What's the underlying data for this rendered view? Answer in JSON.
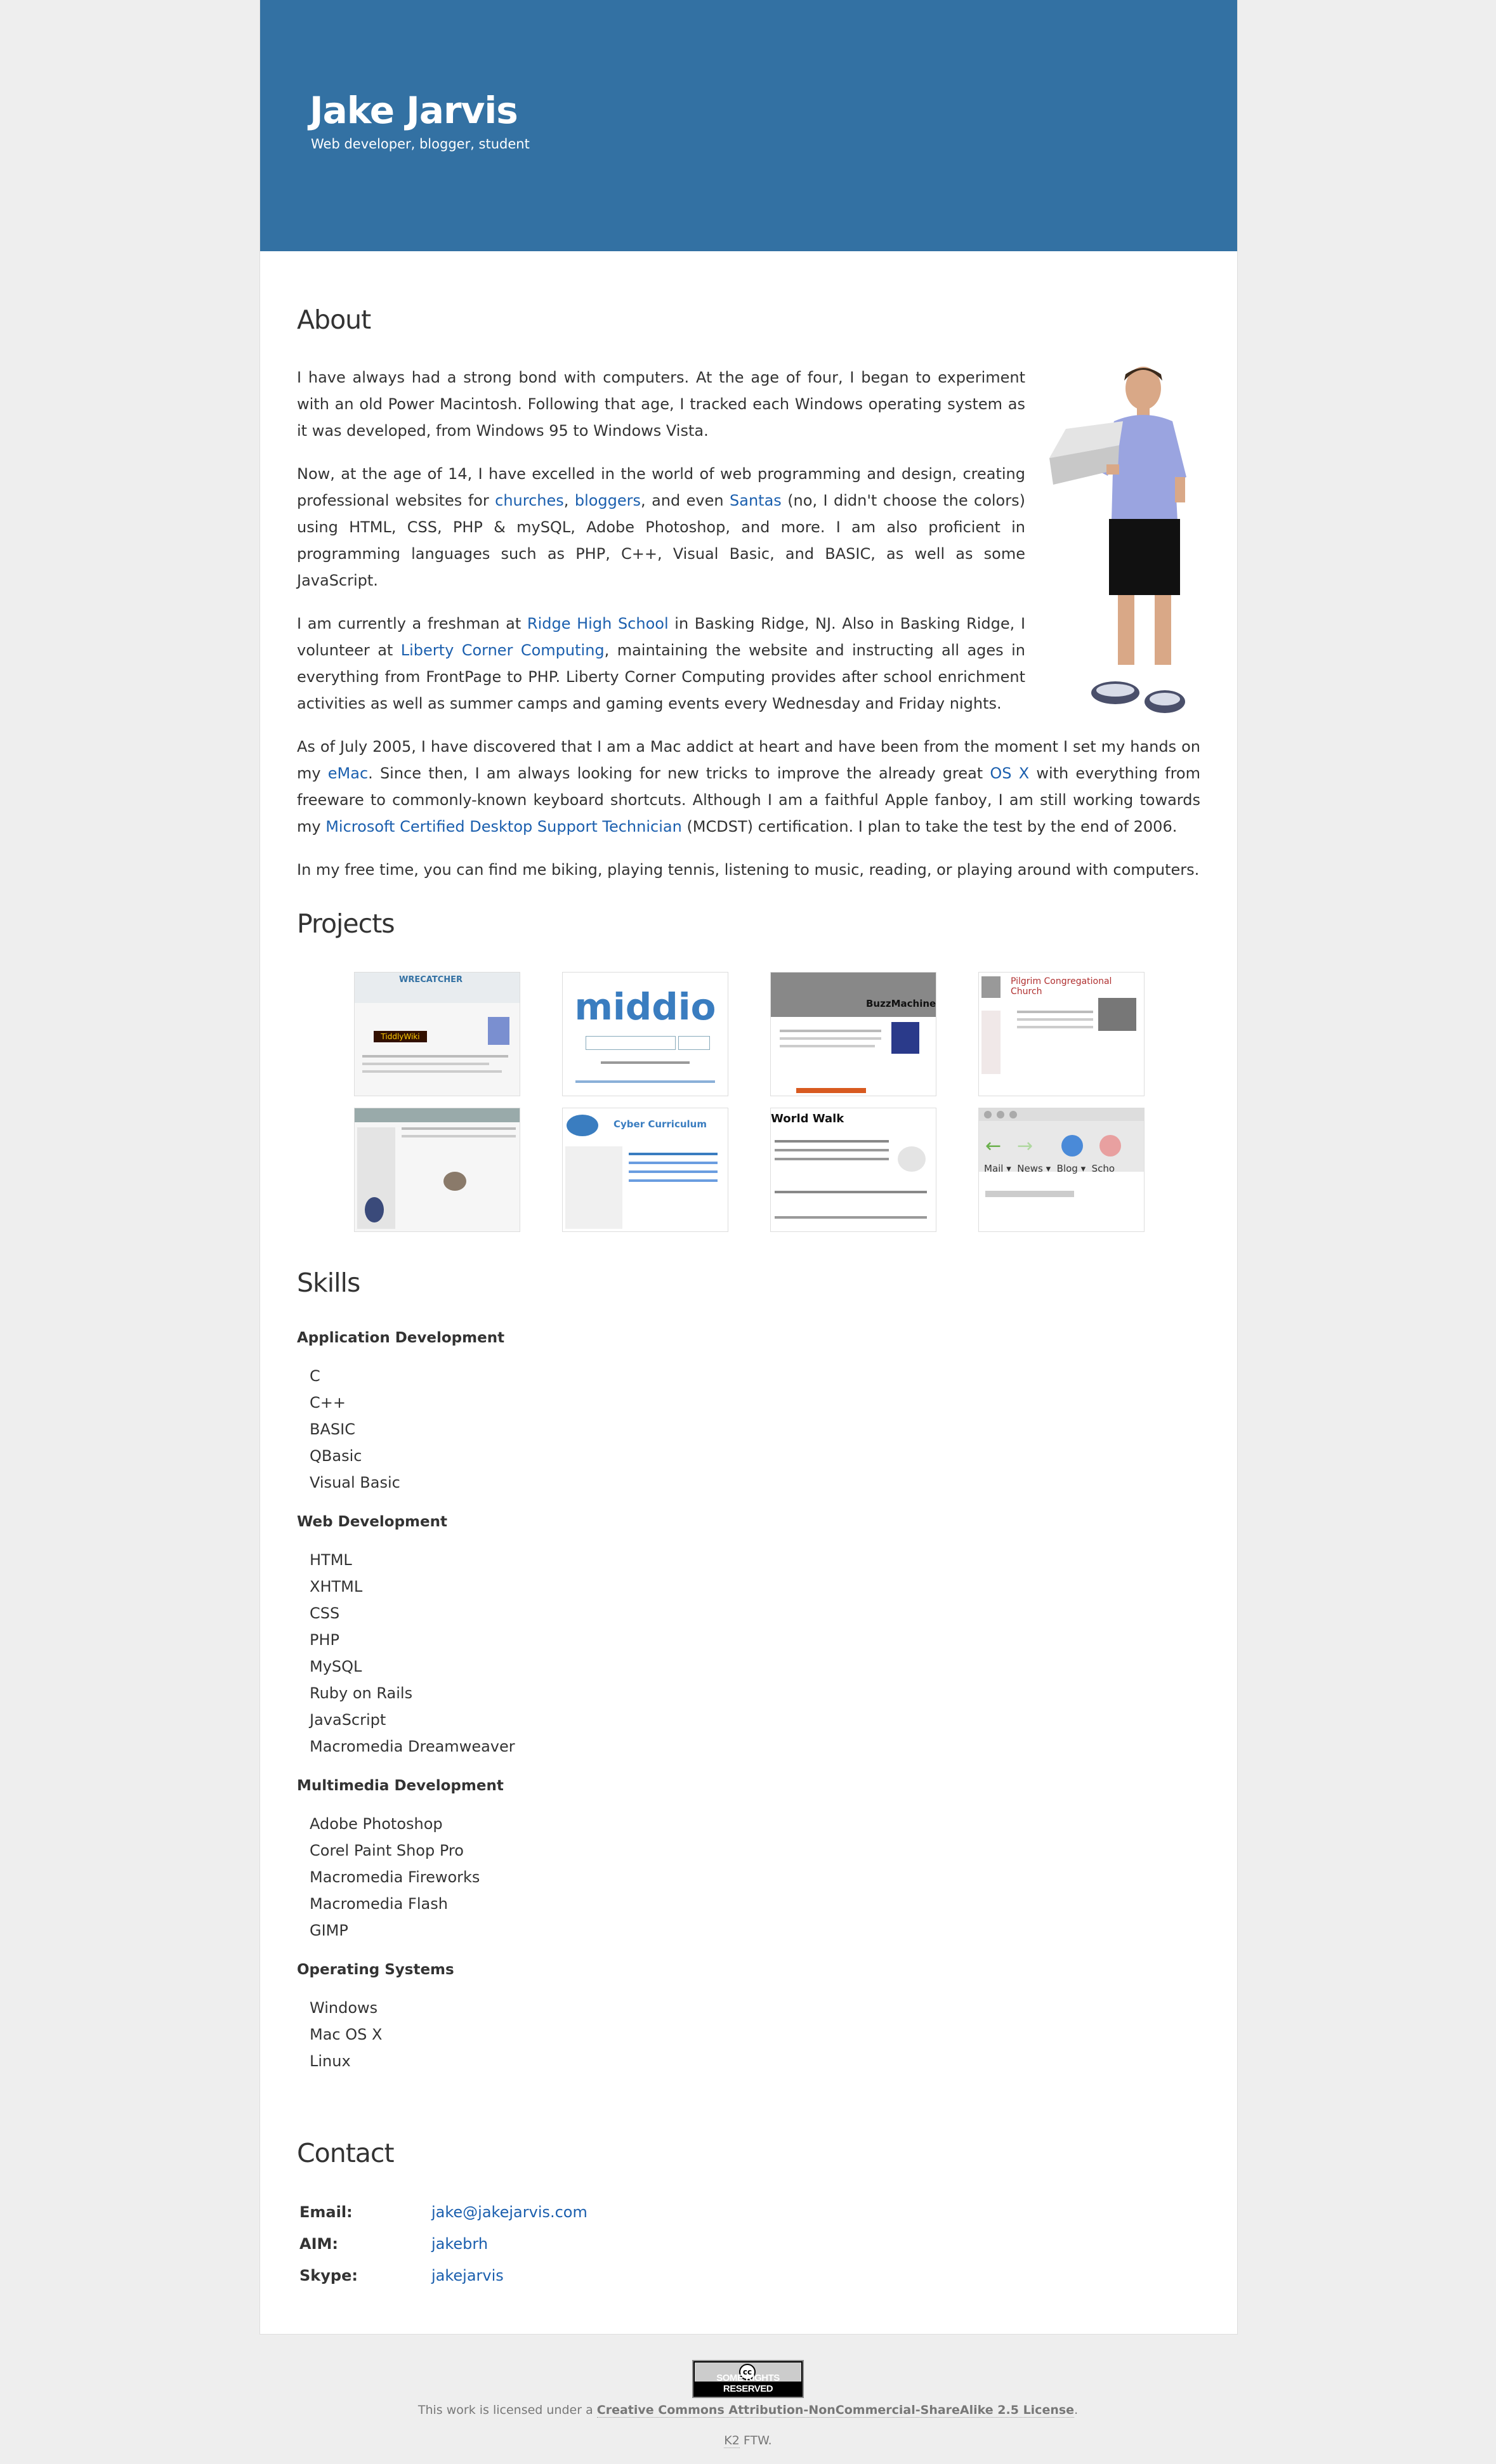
{
  "header": {
    "title": "Jake Jarvis",
    "tagline": "Web developer, blogger, student",
    "color": "#3371a3"
  },
  "about": {
    "title": "About",
    "p1": "I have always had a strong bond with computers. At the age of four, I began to experiment with an old Power Macintosh. Following that age, I tracked each Windows operating system as it was developed, from Windows 95 to Windows Vista.",
    "p2": {
      "t1": "Now, at the age of 14, I have excelled in the world of web programming and design, creating professional websites for ",
      "link_churches": "churches",
      "t2": ", ",
      "link_bloggers": "bloggers",
      "t3": ", and even ",
      "link_santas": "Santas",
      "t4": " (no, I didn't choose the colors) using HTML, CSS, PHP & mySQL, Adobe Photoshop, and more. I am also proficient in programming languages such as PHP, C++, Visual Basic, and BASIC, as well as some JavaScript."
    },
    "p3": {
      "t1": "I am currently a freshman at ",
      "link_ridge": "Ridge High School",
      "t2": " in Basking Ridge, NJ. Also in Basking Ridge, I volunteer at ",
      "link_liberty": "Liberty Corner Computing",
      "t3": ", maintaining the website and instructing all ages in everything from FrontPage to PHP. Liberty Corner Computing provides after school enrichment activities as well as summer camps and gaming events every Wednesday and Friday nights."
    },
    "p4": {
      "t1": "As of July 2005, I have discovered that I am a Mac addict at heart and have been from the moment I set my hands on my ",
      "link_emac": "eMac",
      "t2": ". Since then, I am always looking for new tricks to improve the already great ",
      "link_osx": "OS X",
      "t3": " with everything from freeware to commonly-known keyboard shortcuts. Although I am a faithful Apple fanboy, I am still working towards my ",
      "link_mcdst": "Microsoft Certified Desktop Support Technician",
      "t4": " (MCDST) certification. I plan to take the test by the end of 2006."
    },
    "p5": "In my free time, you can find me biking, playing tennis, listening to music, reading, or playing around with computers."
  },
  "projects": {
    "title": "Projects",
    "items": [
      {
        "icon": "wiki-site-screenshot",
        "caption": "TiddlyWiki"
      },
      {
        "icon": "middio-site-screenshot",
        "caption": "middio"
      },
      {
        "icon": "buzzmachine-site-screenshot",
        "caption": "BuzzMachine"
      },
      {
        "icon": "church-site-screenshot",
        "caption": "Pilgrim Congregational Church"
      },
      {
        "icon": "liberty-site-screenshot",
        "caption": ""
      },
      {
        "icon": "cyber-curriculum-screenshot",
        "caption": "Cyber Curriculum"
      },
      {
        "icon": "world-walk-screenshot",
        "caption": "World Walk"
      },
      {
        "icon": "browser-toolbar-screenshot",
        "caption": ""
      }
    ]
  },
  "skills": {
    "title": "Skills",
    "categories": [
      {
        "name": "Application Development",
        "items": [
          "C",
          "C++",
          "BASIC",
          "QBasic",
          "Visual Basic"
        ]
      },
      {
        "name": "Web Development",
        "items": [
          "HTML",
          "XHTML",
          "CSS",
          "PHP",
          "MySQL",
          "Ruby on Rails",
          "JavaScript",
          "Macromedia Dreamweaver"
        ]
      },
      {
        "name": "Multimedia Development",
        "items": [
          "Adobe Photoshop",
          "Corel Paint Shop Pro",
          "Macromedia Fireworks",
          "Macromedia Flash",
          "GIMP"
        ]
      },
      {
        "name": "Operating Systems",
        "items": [
          "Windows",
          "Mac OS X",
          "Linux"
        ]
      }
    ]
  },
  "contact": {
    "title": "Contact",
    "rows": [
      {
        "label": "Email:",
        "value": "jake@jakejarvis.com"
      },
      {
        "label": "AIM:",
        "value": "jakebrh"
      },
      {
        "label": "Skype:",
        "value": "jakejarvis"
      }
    ]
  },
  "footer": {
    "badge_text": "SOME RIGHTS RESERVED",
    "badge_logo": "cc",
    "license_prefix": "This work is licensed under a ",
    "license_link": "Creative Commons Attribution-NonCommercial-ShareAlike 2.5 License",
    "license_suffix": ".",
    "k2_link": "K2",
    "k2_suffix": " FTW."
  }
}
